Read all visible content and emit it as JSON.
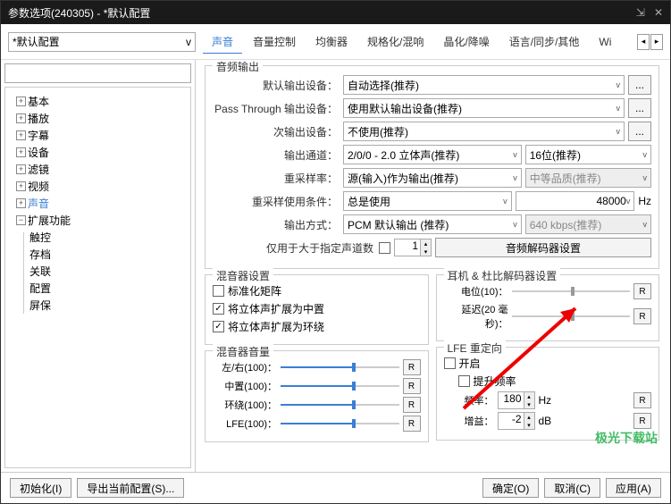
{
  "title": "参数选项(240305) - *默认配置",
  "configSelect": "*默认配置",
  "tabs": [
    "声音",
    "音量控制",
    "均衡器",
    "规格化/混响",
    "晶化/降噪",
    "语言/同步/其他",
    "Wi"
  ],
  "activeTab": 0,
  "tree": {
    "top": [
      "基本",
      "播放",
      "字幕",
      "设备",
      "滤镜",
      "视频",
      "声音",
      "扩展功能"
    ],
    "activeIdx": 6,
    "sub": [
      "触控",
      "存档",
      "关联",
      "配置",
      "屏保"
    ]
  },
  "audioOutput": {
    "legend": "音频输出",
    "defaultDeviceLabel": "默认输出设备：",
    "defaultDevice": "自动选择(推荐)",
    "passThroughLabel": "Pass Through 输出设备：",
    "passThrough": "使用默认输出设备(推荐)",
    "secondaryLabel": "次输出设备：",
    "secondary": "不使用(推荐)",
    "channelsLabel": "输出通道：",
    "channels": "2/0/0 - 2.0 立体声(推荐)",
    "bitdepth": "16位(推荐)",
    "resampleRateLabel": "重采样率：",
    "resampleRate": "源(输入)作为输出(推荐)",
    "quality": "中等品质(推荐)",
    "resampleCondLabel": "重采样使用条件：",
    "resampleCond": "总是使用",
    "resampleHz": "48000",
    "hzUnit": "Hz",
    "outputModeLabel": "输出方式：",
    "outputMode": "PCM 默认输出 (推荐)",
    "bitrate": "640 kbps(推荐)",
    "onlyGreaterLabel": "仅用于大于指定声道数",
    "onlyGreaterNum": "1",
    "decoderBtn": "音频解码器设置"
  },
  "mixer": {
    "legend": "混音器设置",
    "normMatrix": "标准化矩阵",
    "stereoCenter": "将立体声扩展为中置",
    "stereoSurround": "将立体声扩展为环绕",
    "volLegend": "混音器音量",
    "sliders": [
      {
        "label": "左/右(100)：",
        "val": 60
      },
      {
        "label": "中置(100)：",
        "val": 60
      },
      {
        "label": "环绕(100)：",
        "val": 60
      },
      {
        "label": "LFE(100)：",
        "val": 60
      }
    ],
    "resetChar": "R"
  },
  "headphone": {
    "legend": "耳机 & 杜比解码器设置",
    "potLabel": "电位(10)：",
    "delayLabel": "延迟(20 毫秒)：",
    "resetChar": "R"
  },
  "lfe": {
    "legend": "LFE 重定向",
    "enable": "开启",
    "boost": "提升频率",
    "freqLabel": "频率：",
    "freq": "180",
    "freqUnit": "Hz",
    "gainLabel": "增益：",
    "gain": "-2",
    "gainUnit": "dB",
    "resetChar": "R"
  },
  "footer": {
    "init": "初始化(I)",
    "export": "导出当前配置(S)...",
    "ok": "确定(O)",
    "cancel": "取消(C)",
    "apply": "应用(A)"
  },
  "watermark": "极光下载站"
}
